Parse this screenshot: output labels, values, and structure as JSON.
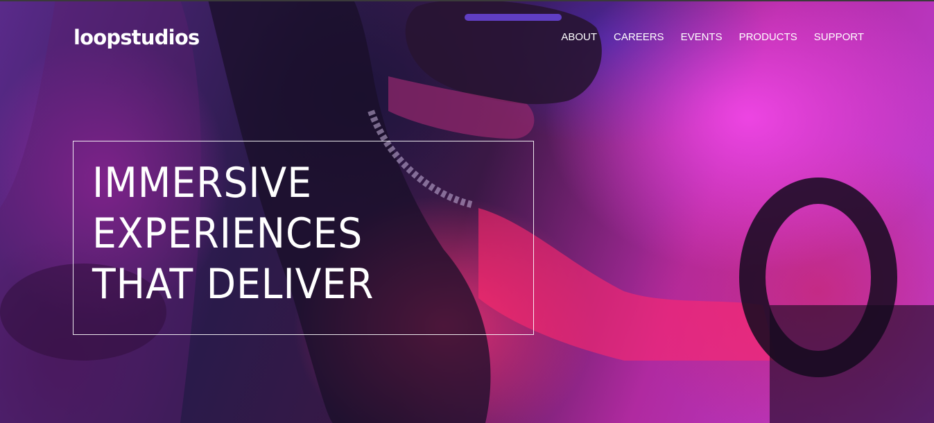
{
  "brand": {
    "logo_text": "loopstudios"
  },
  "nav": {
    "items": [
      {
        "label": "ABOUT"
      },
      {
        "label": "CAREERS"
      },
      {
        "label": "EVENTS"
      },
      {
        "label": "PRODUCTS"
      },
      {
        "label": "SUPPORT"
      }
    ]
  },
  "hero": {
    "headline_lines": [
      "IMMERSIVE",
      "EXPERIENCES",
      "THAT DELIVER"
    ],
    "background_image": "person-wearing-vr-headset-driving-simulator",
    "colors": {
      "magenta": "#e040e0",
      "hot_pink": "#ff3278",
      "violet": "#5a2a8a",
      "text": "#ffffff"
    }
  }
}
